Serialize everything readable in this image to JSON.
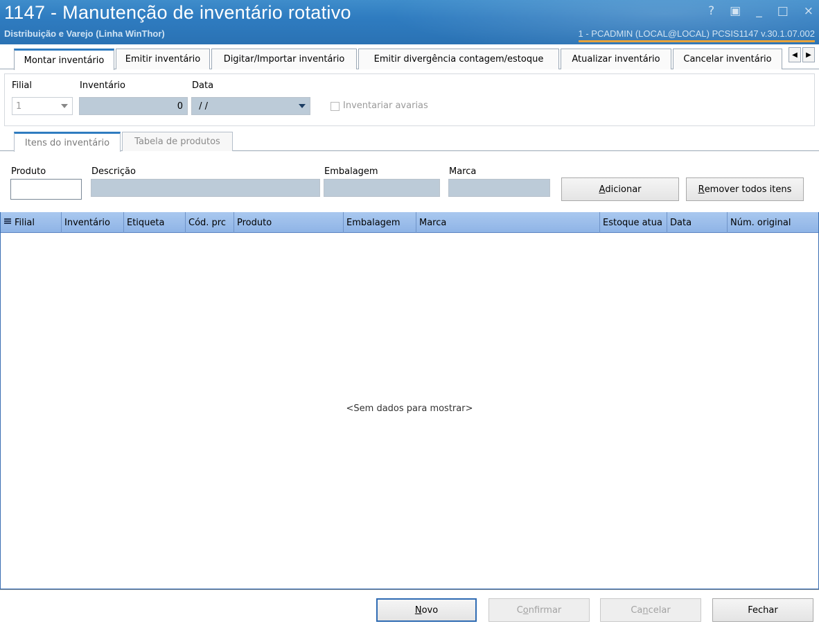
{
  "window": {
    "title": "1147 - Manutenção de inventário rotativo",
    "subtitle": "Distribuição e Varejo (Linha WinThor)",
    "user_info": "1 - PCADMIN (LOCAL@LOCAL)   PCSIS1147  v.30.1.07.002",
    "controls": {
      "help": "?",
      "restore": "▣",
      "minimize": "_",
      "maximize": "□",
      "close": "×"
    }
  },
  "tabs": [
    {
      "label": "Montar inventário",
      "active": true
    },
    {
      "label": "Emitir inventário"
    },
    {
      "label": "Digitar/Importar inventário"
    },
    {
      "label": "Emitir divergência contagem/estoque"
    },
    {
      "label": "Atualizar inventário"
    },
    {
      "label": "Cancelar inventário"
    }
  ],
  "tab_scroll": {
    "left": "◀",
    "right": "▶"
  },
  "header": {
    "filial_label": "Filial",
    "filial_value": "1",
    "inventario_label": "Inventário",
    "inventario_value": "0",
    "data_label": "Data",
    "data_value": " / /",
    "avarias_label": "Inventariar avarias",
    "avarias_checked": false
  },
  "subtabs": [
    {
      "label": "Itens do inventário",
      "active": true
    },
    {
      "label": "Tabela de produtos"
    }
  ],
  "entry": {
    "produto_label": "Produto",
    "produto_value": "",
    "descricao_label": "Descrição",
    "descricao_value": "",
    "embalagem_label": "Embalagem",
    "embalagem_value": "",
    "marca_label": "Marca",
    "marca_value": "",
    "add_button": {
      "accel": "A",
      "rest": "dicionar"
    },
    "remove_button": {
      "accel": "R",
      "rest": "emover todos itens"
    }
  },
  "grid": {
    "columns": [
      "Filial",
      "Inventário",
      "Etiqueta",
      "Cód. prc",
      "Produto",
      "Embalagem",
      "Marca",
      "Estoque atua",
      "Data",
      "Núm. original"
    ],
    "rows": [],
    "empty_text": "<Sem dados para mostrar>"
  },
  "footer": {
    "novo": {
      "accel": "N",
      "rest": "ovo"
    },
    "confirmar": {
      "pre": "C",
      "accel": "o",
      "rest": "nfirmar"
    },
    "cancelar": {
      "pre": "Ca",
      "accel": "n",
      "rest": "celar"
    },
    "fechar": "Fechar"
  },
  "colors": {
    "accent": "#2f7cc0",
    "grid_header": "#99bbea",
    "readonly_field": "#bccbd8"
  }
}
